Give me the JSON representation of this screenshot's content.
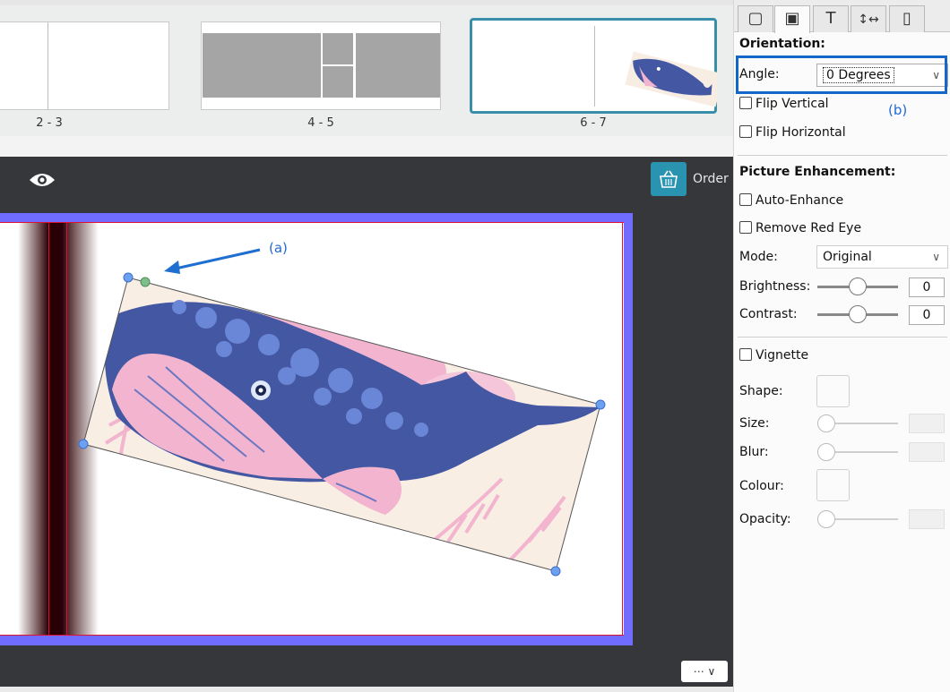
{
  "thumbnails": [
    {
      "label": "2 - 3"
    },
    {
      "label": "4 - 5"
    },
    {
      "label": "6 - 7",
      "selected": true
    }
  ],
  "canvas": {
    "toolbar": {
      "eye_icon": "eye-icon",
      "order_icon": "basket-icon",
      "order_label": "Order"
    },
    "more_button": {
      "label": "⋯ ∨"
    },
    "annotation_a": "(a)"
  },
  "panel": {
    "tabs": [
      {
        "icon": "frame-icon",
        "glyph": "▢"
      },
      {
        "icon": "picture-icon",
        "glyph": "▣",
        "active": true
      },
      {
        "icon": "text-icon",
        "glyph": "T"
      },
      {
        "icon": "spacing-icon",
        "glyph": "↕↔"
      },
      {
        "icon": "page-icon",
        "glyph": "▯"
      }
    ],
    "orientation": {
      "title": "Orientation:",
      "angle_label": "Angle:",
      "angle_value": "0 Degrees",
      "flip_vertical": "Flip Vertical",
      "flip_horizontal": "Flip Horizontal",
      "annotation_b": "(b)"
    },
    "enhancement": {
      "title": "Picture Enhancement:",
      "auto_enhance": "Auto-Enhance",
      "remove_red_eye": "Remove Red Eye",
      "mode_label": "Mode:",
      "mode_value": "Original",
      "brightness_label": "Brightness:",
      "brightness_value": "0",
      "contrast_label": "Contrast:",
      "contrast_value": "0"
    },
    "vignette": {
      "label": "Vignette",
      "shape_label": "Shape:",
      "size_label": "Size:",
      "blur_label": "Blur:",
      "colour_label": "Colour:",
      "opacity_label": "Opacity:"
    }
  },
  "colors": {
    "accent": "#2a93b0",
    "page_border": "#6f6cff",
    "annotation": "#1467c9",
    "whale": "#4457a3",
    "pink": "#f2b4cf"
  }
}
